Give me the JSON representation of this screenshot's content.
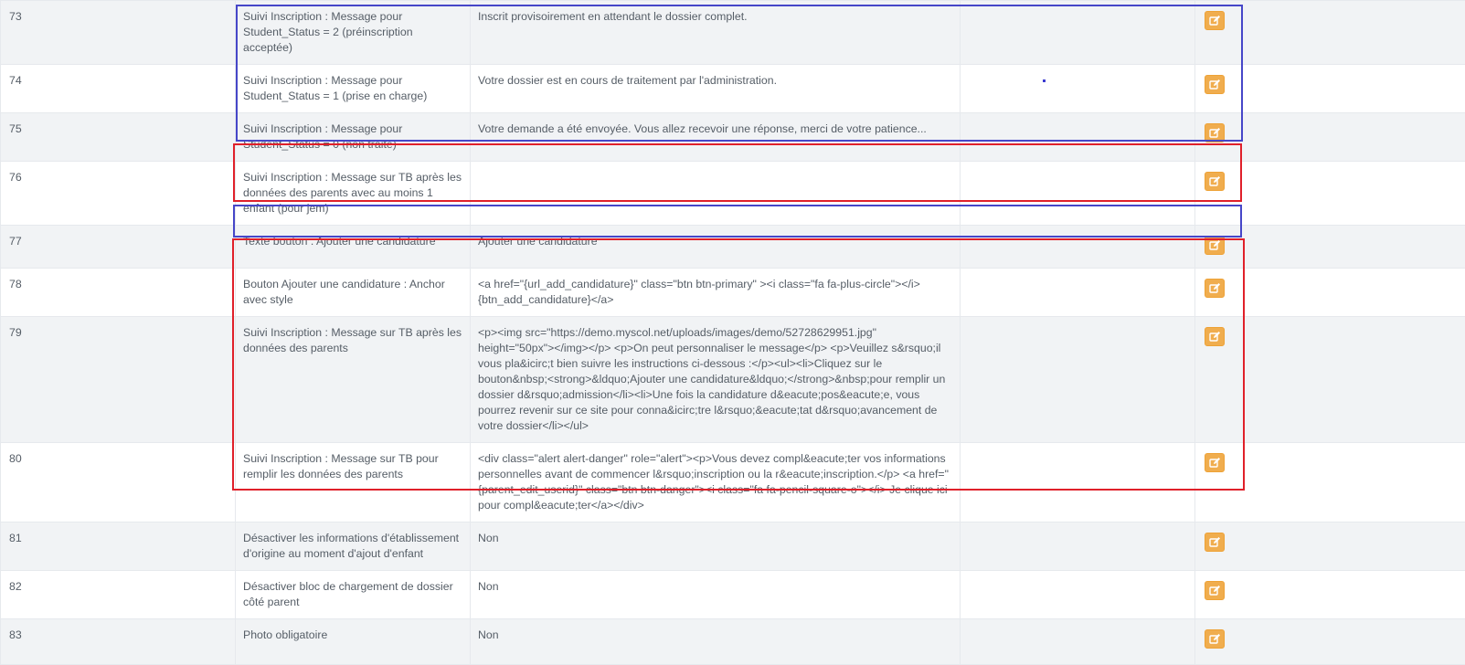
{
  "rows": [
    {
      "id": "73",
      "name": "Suivi Inscription : Message pour Student_Status = 2 (préinscription acceptée)",
      "value": "Inscrit provisoirement en attendant le dossier complet.",
      "extra": ""
    },
    {
      "id": "74",
      "name": "Suivi Inscription : Message pour Student_Status = 1 (prise en charge)",
      "value": "Votre dossier est en cours de traitement par l'administration.",
      "extra": ""
    },
    {
      "id": "75",
      "name": "Suivi Inscription : Message pour Student_Status = 0 (non traité)",
      "value": "Votre demande a été envoyée. Vous allez recevoir une réponse, merci de votre patience...",
      "extra": ""
    },
    {
      "id": "76",
      "name": "Suivi Inscription : Message sur TB après les données des parents avec au moins 1 enfant (pour jem)",
      "value": "",
      "extra": ""
    },
    {
      "id": "77",
      "name": "Texte bouton : Ajouter une candidature",
      "value": "Ajouter une candidature",
      "extra": ""
    },
    {
      "id": "78",
      "name": "Bouton Ajouter une candidature : Anchor avec style",
      "value": "<a href=\"{url_add_candidature}\" class=\"btn btn-primary\" ><i class=\"fa fa-plus-circle\"></i> {btn_add_candidature}</a>",
      "extra": ""
    },
    {
      "id": "79",
      "name": "Suivi Inscription : Message sur TB après les données des parents",
      "value": "<p><img src=\"https://demo.myscol.net/uploads/images/demo/52728629951.jpg\" height=\"50px\"></img></p> <p>On peut personnaliser le message</p> <p>Veuillez s&rsquo;il vous pla&icirc;t bien suivre les instructions ci-dessous :</p><ul><li>Cliquez sur le bouton&nbsp;<strong>&ldquo;Ajouter une candidature&ldquo;</strong>&nbsp;pour remplir un dossier d&rsquo;admission</li><li>Une fois la candidature d&eacute;pos&eacute;e, vous pourrez revenir sur ce site pour conna&icirc;tre l&rsquo;&eacute;tat d&rsquo;avancement de votre dossier</li></ul>",
      "extra": ""
    },
    {
      "id": "80",
      "name": "Suivi Inscription : Message sur TB pour remplir les données des parents",
      "value": "<div class=\"alert alert-danger\" role=\"alert\"><p>Vous devez compl&eacute;ter vos informations personnelles avant de commencer l&rsquo;inscription ou la r&eacute;inscription.</p> <a href=\"{parent_edit_userid}\" class=\"btn btn-danger\"><i class=\"fa fa-pencil-square-o\"></i> Je clique ici pour compl&eacute;ter</a></div>",
      "extra": ""
    },
    {
      "id": "81",
      "name": "Désactiver les informations d'établissement d'origine au moment d'ajout d'enfant",
      "value": "Non",
      "extra": ""
    },
    {
      "id": "82",
      "name": "Désactiver bloc de chargement de dossier côté parent",
      "value": "Non",
      "extra": ""
    },
    {
      "id": "83",
      "name": "Photo obligatoire",
      "value": "Non",
      "extra": ""
    }
  ],
  "edit_icon": "edit-icon",
  "colors": {
    "edit_button": "#f0ad4e",
    "highlight_blue": "#4646c8",
    "highlight_red": "#e0202a",
    "row_stripe": "#f1f3f5"
  }
}
